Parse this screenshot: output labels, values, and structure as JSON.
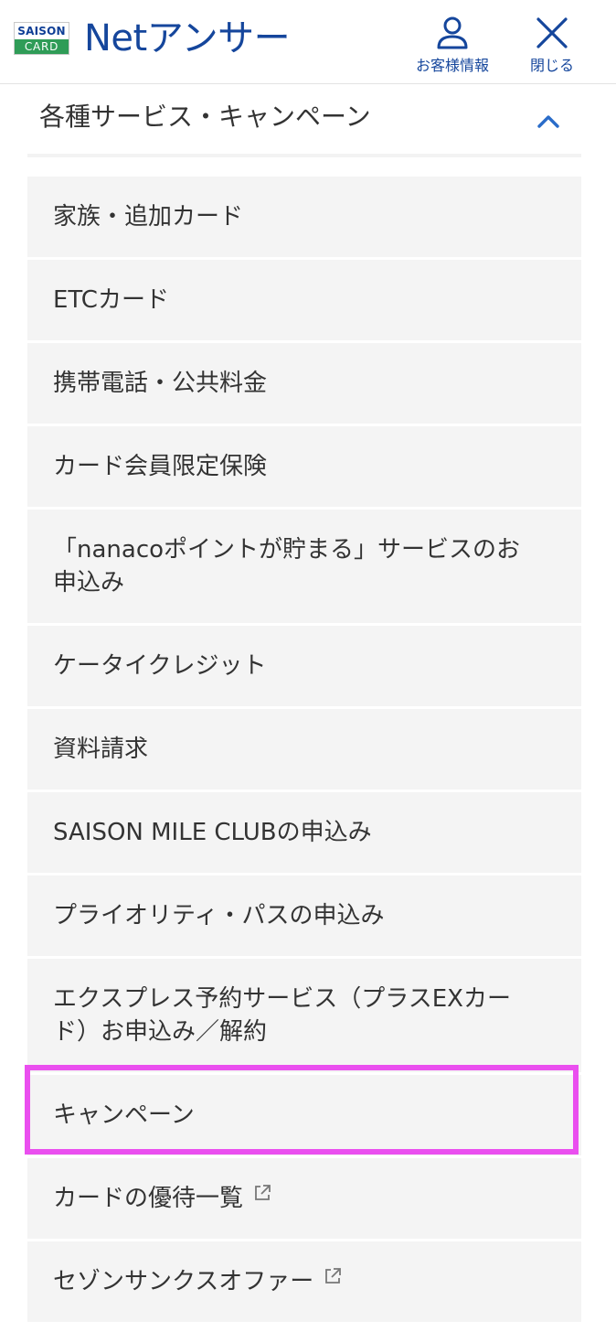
{
  "header": {
    "logo_top": "SAISON",
    "logo_bottom": "CARD",
    "app_title": "Netアンサー",
    "account_label": "お客様情報",
    "account_icon": "person-icon",
    "close_label": "閉じる",
    "close_icon": "close-icon",
    "brand_color": "#15469c",
    "logo_green": "#2f9c57"
  },
  "section": {
    "title": "各種サービス・キャンペーン",
    "toggle_icon": "chevron-up-icon",
    "accent_color": "#2a6cc9"
  },
  "menu": {
    "items": [
      {
        "line1": "家族・追加カード",
        "line2": ""
      },
      {
        "line1": "ETCカード",
        "line2": ""
      },
      {
        "line1": "携帯電話・公共料金",
        "line2": ""
      },
      {
        "line1": "カード会員限定保険",
        "line2": ""
      },
      {
        "line1": "「nanacoポイントが貯まる」サービスのお",
        "line2": "申込み"
      },
      {
        "line1": "ケータイクレジット",
        "line2": ""
      },
      {
        "line1": "資料請求",
        "line2": ""
      },
      {
        "line1": "SAISON MILE CLUBの申込み",
        "line2": ""
      },
      {
        "line1": "プライオリティ・パスの申込み",
        "line2": ""
      },
      {
        "line1": "エクスプレス予約サービス（プラスEXカー",
        "line2": "ド）お申込み／解約"
      },
      {
        "line1": "キャンペーン",
        "line2": "",
        "highlighted": true
      },
      {
        "line1": "カードの優待一覧",
        "line2": "",
        "external": true,
        "icon": "external-link-icon"
      },
      {
        "line1": "セゾンサンクスオファー",
        "line2": "",
        "external": true,
        "icon": "external-link-icon"
      }
    ],
    "item_background": "#f4f4f4",
    "highlight_color": "#ea4fef"
  }
}
